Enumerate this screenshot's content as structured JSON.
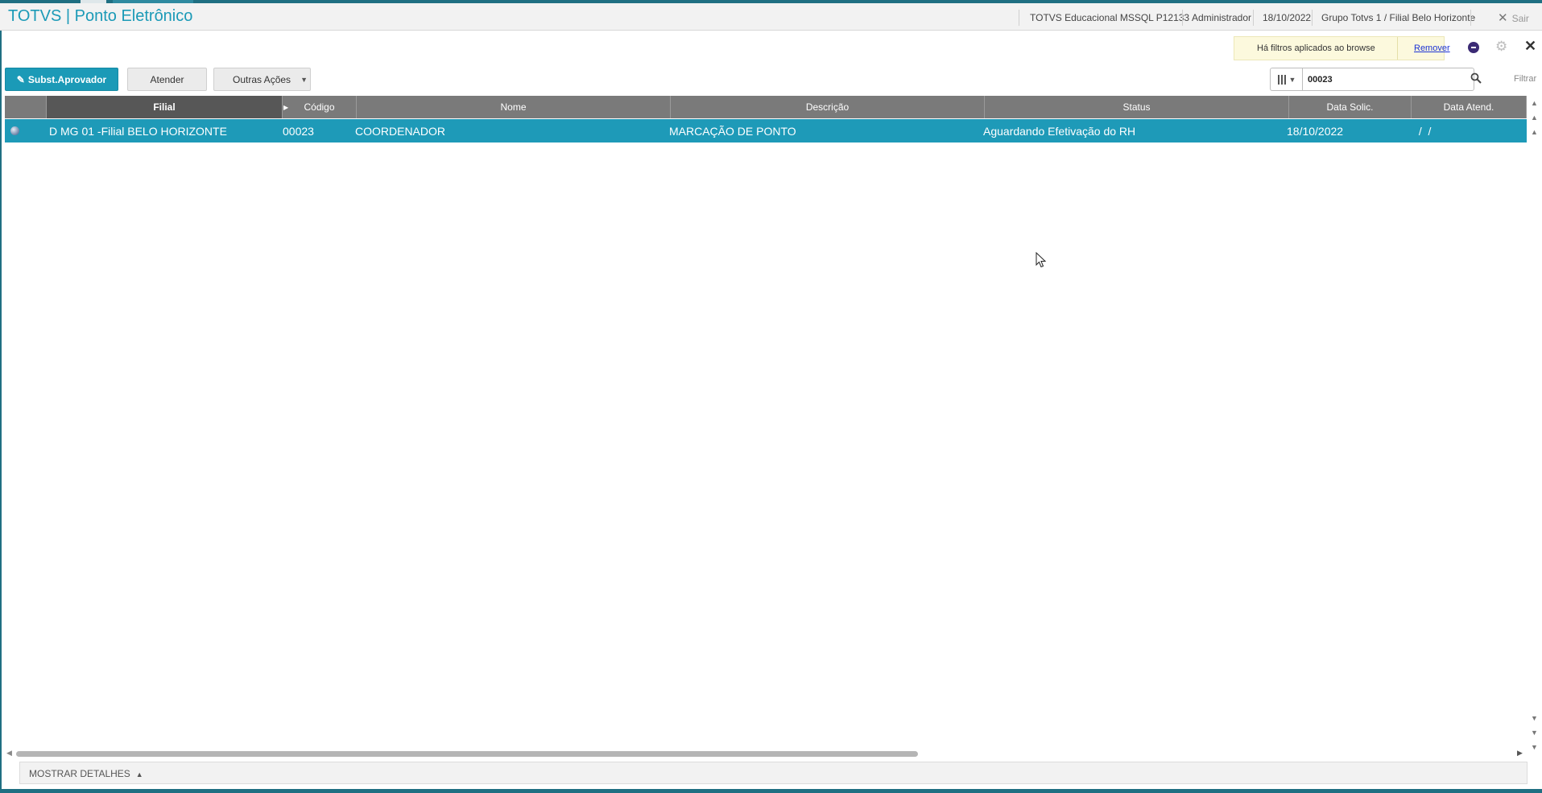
{
  "header": {
    "app_title": "TOTVS | Ponto Eletrônico",
    "environment": "TOTVS Educacional MSSQL P12133",
    "user": "Administrador",
    "date": "18/10/2022",
    "company": "Grupo Totvs 1 / Filial Belo Horizonte",
    "logout_label": "Sair"
  },
  "filter_notice": {
    "text": "Há filtros aplicados ao browse",
    "remove_label": "Remover"
  },
  "toolbar": {
    "primary_label": "Subst.Aprovador",
    "atender_label": "Atender",
    "outras_label": "Outras Ações"
  },
  "search": {
    "value": "00023",
    "filter_label": "Filtrar"
  },
  "grid": {
    "columns": [
      "Filial",
      "Código",
      "Nome",
      "Descrição",
      "Status",
      "Data Solic.",
      "Data Atend."
    ],
    "rows": [
      {
        "filial": "D MG 01 -Filial BELO HORIZONTE",
        "codigo": "00023",
        "nome": "COORDENADOR",
        "descricao": "MARCAÇÃO DE PONTO",
        "status": "Aguardando Efetivação do RH",
        "data_solic": "18/10/2022",
        "data_atend": " /  /"
      }
    ]
  },
  "footer": {
    "details_label": "MOSTRAR DETALHES"
  },
  "colors": {
    "accent": "#1b9ab7",
    "selected_row": "#1e9ab8",
    "grid_header": "#7a7a7a",
    "notice_bg": "#fcf9dd"
  }
}
